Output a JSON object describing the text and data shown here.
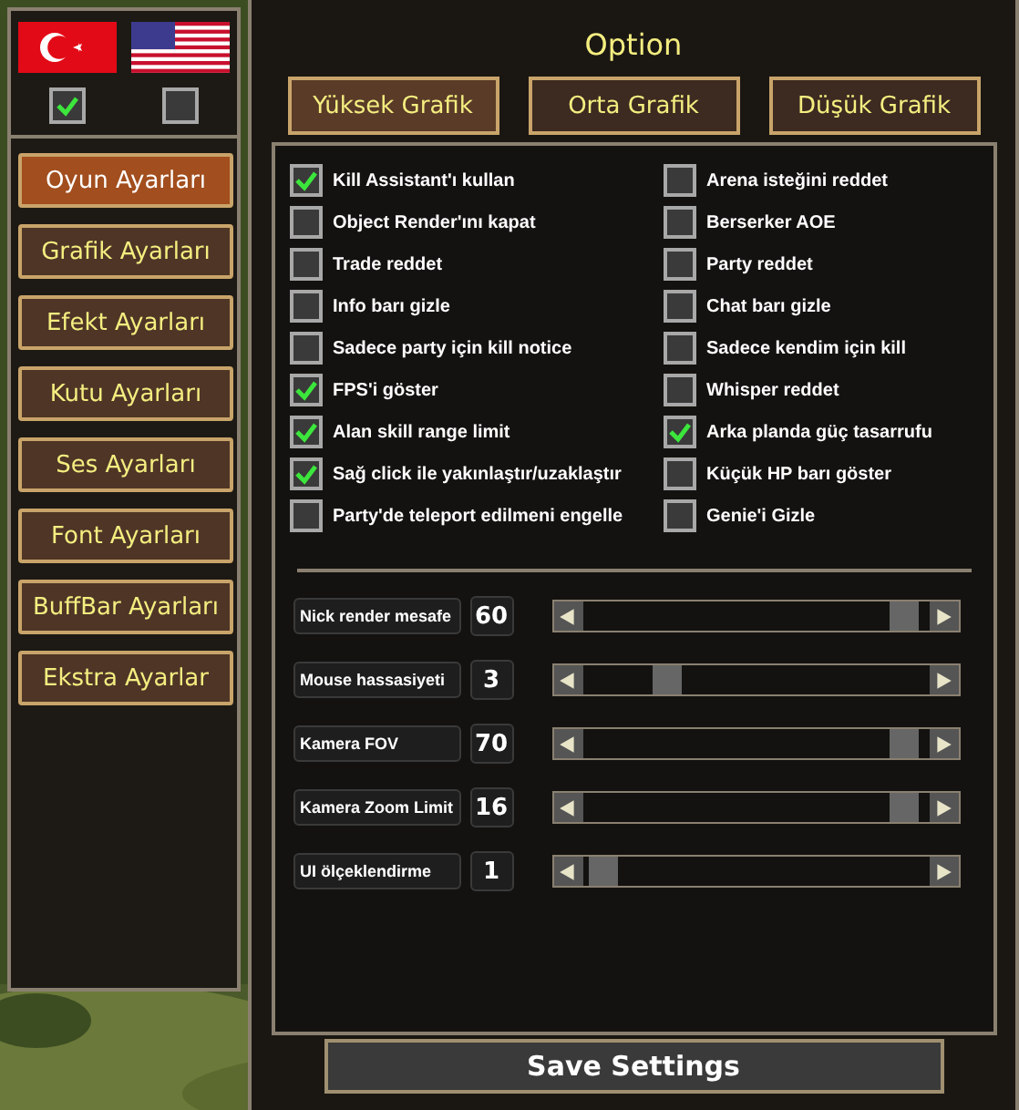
{
  "languages": [
    {
      "kind": "turkish",
      "checked": true
    },
    {
      "kind": "english",
      "checked": false
    }
  ],
  "menu": [
    {
      "label": "Oyun Ayarları",
      "selected": true
    },
    {
      "label": "Grafik Ayarları",
      "selected": false
    },
    {
      "label": "Efekt Ayarları",
      "selected": false
    },
    {
      "label": "Kutu Ayarları",
      "selected": false
    },
    {
      "label": "Ses Ayarları",
      "selected": false
    },
    {
      "label": "Font Ayarları",
      "selected": false
    },
    {
      "label": "BuffBar Ayarları",
      "selected": false
    },
    {
      "label": "Ekstra Ayarlar",
      "selected": false
    }
  ],
  "window": {
    "title": "Option"
  },
  "tabs": [
    {
      "label": "Yüksek Grafik",
      "selected": true
    },
    {
      "label": "Orta Grafik",
      "selected": false
    },
    {
      "label": "Düşük Grafik",
      "selected": false
    }
  ],
  "options": [
    {
      "label": "Kill Assistant'ı kullan",
      "checked": true
    },
    {
      "label": "Arena isteğini reddet",
      "checked": false
    },
    {
      "label": "Object Render'ını kapat",
      "checked": false
    },
    {
      "label": "Berserker AOE",
      "checked": false
    },
    {
      "label": "Trade reddet",
      "checked": false
    },
    {
      "label": "Party reddet",
      "checked": false
    },
    {
      "label": "Info barı gizle",
      "checked": false
    },
    {
      "label": "Chat barı gizle",
      "checked": false
    },
    {
      "label": "Sadece party için kill notice",
      "checked": false
    },
    {
      "label": "Sadece kendim için kill",
      "checked": false
    },
    {
      "label": "FPS'i göster",
      "checked": true
    },
    {
      "label": "Whisper reddet",
      "checked": false
    },
    {
      "label": "Alan skill range limit",
      "checked": true
    },
    {
      "label": "Arka planda güç tasarrufu",
      "checked": true
    },
    {
      "label": "Sağ click ile yakınlaştır/uzaklaştır",
      "checked": true
    },
    {
      "label": "Küçük HP barı göster",
      "checked": false
    },
    {
      "label": "Party'de teleport edilmeni engelle",
      "checked": false
    },
    {
      "label": "Genie'i Gizle",
      "checked": false
    }
  ],
  "sliders": [
    {
      "label": "Nick render mesafe",
      "value": "60",
      "level": 0.97
    },
    {
      "label": "Mouse hassasiyeti",
      "value": "3",
      "level": 0.22
    },
    {
      "label": "Kamera FOV",
      "value": "70",
      "level": 0.97
    },
    {
      "label": "Kamera Zoom Limit",
      "value": "16",
      "level": 0.97
    },
    {
      "label": "UI ölçeklendirme",
      "value": "1",
      "level": 0.02
    }
  ],
  "save_button": "Save Settings"
}
